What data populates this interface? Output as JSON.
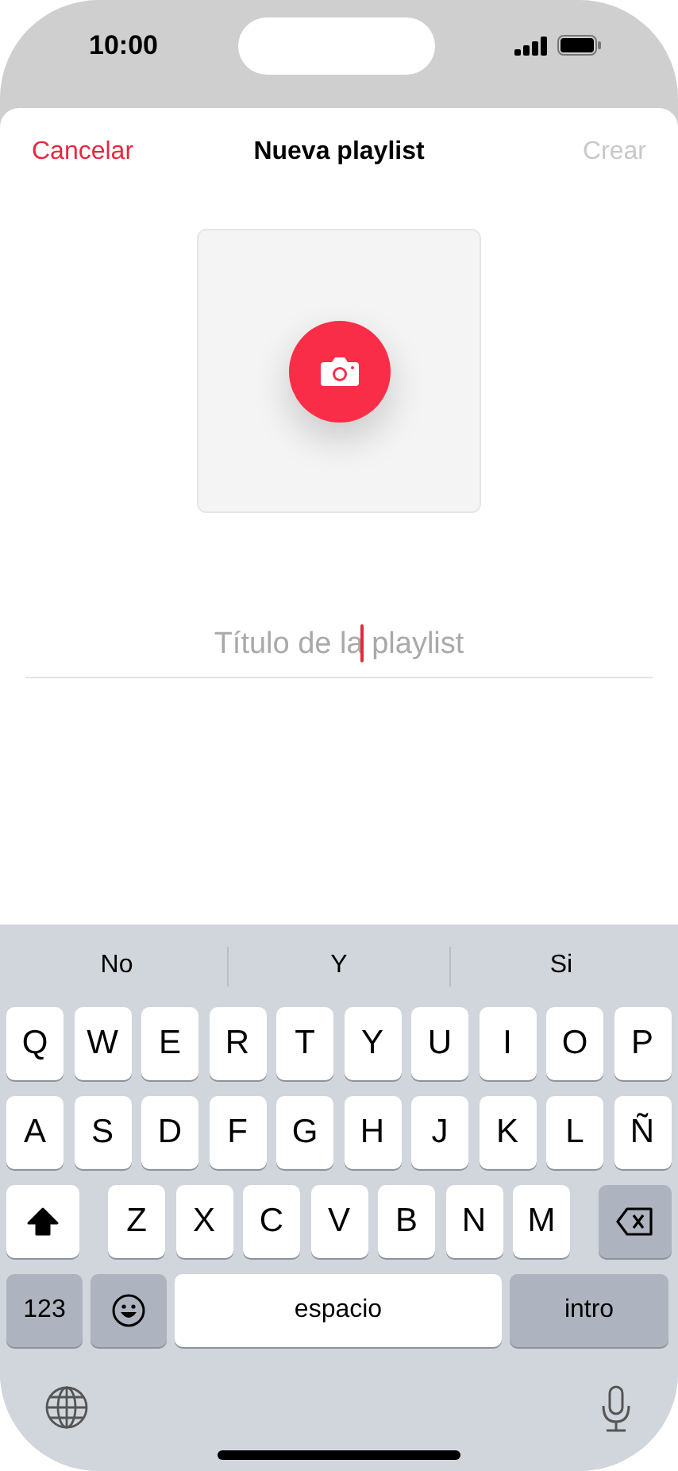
{
  "status_bar": {
    "time": "10:00"
  },
  "header": {
    "cancel": "Cancelar",
    "title": "Nueva playlist",
    "create": {
      "label": "Crear",
      "disabled": true
    }
  },
  "artwork": {
    "kind": "camera-button"
  },
  "title_field": {
    "placeholder": "Título de la playlist",
    "focused": true
  },
  "suggestions": [
    "No",
    "Y",
    "Si"
  ],
  "keyboard": {
    "rows": [
      {
        "keys": [
          {
            "kind": "letter",
            "label": "Q"
          },
          {
            "kind": "letter",
            "label": "W"
          },
          {
            "kind": "letter",
            "label": "E"
          },
          {
            "kind": "letter",
            "label": "R"
          },
          {
            "kind": "letter",
            "label": "T"
          },
          {
            "kind": "letter",
            "label": "Y"
          },
          {
            "kind": "letter",
            "label": "U"
          },
          {
            "kind": "letter",
            "label": "I"
          },
          {
            "kind": "letter",
            "label": "O"
          },
          {
            "kind": "letter",
            "label": "P"
          }
        ]
      },
      {
        "keys": [
          {
            "kind": "letter",
            "label": "A"
          },
          {
            "kind": "letter",
            "label": "S"
          },
          {
            "kind": "letter",
            "label": "D"
          },
          {
            "kind": "letter",
            "label": "F"
          },
          {
            "kind": "letter",
            "label": "G"
          },
          {
            "kind": "letter",
            "label": "H"
          },
          {
            "kind": "letter",
            "label": "J"
          },
          {
            "kind": "letter",
            "label": "K"
          },
          {
            "kind": "letter",
            "label": "L"
          },
          {
            "kind": "letter",
            "label": "Ñ"
          }
        ]
      },
      {
        "keys": [
          {
            "kind": "shift",
            "on": true
          },
          {
            "kind": "letter",
            "label": "Z"
          },
          {
            "kind": "letter",
            "label": "X"
          },
          {
            "kind": "letter",
            "label": "C"
          },
          {
            "kind": "letter",
            "label": "V"
          },
          {
            "kind": "letter",
            "label": "B"
          },
          {
            "kind": "letter",
            "label": "N"
          },
          {
            "kind": "letter",
            "label": "M"
          },
          {
            "kind": "delete"
          }
        ]
      },
      {
        "keys": [
          {
            "kind": "numbers",
            "label": "123"
          },
          {
            "kind": "emoji"
          },
          {
            "kind": "space",
            "label": "espacio"
          },
          {
            "kind": "return",
            "label": "intro"
          }
        ]
      }
    ]
  }
}
